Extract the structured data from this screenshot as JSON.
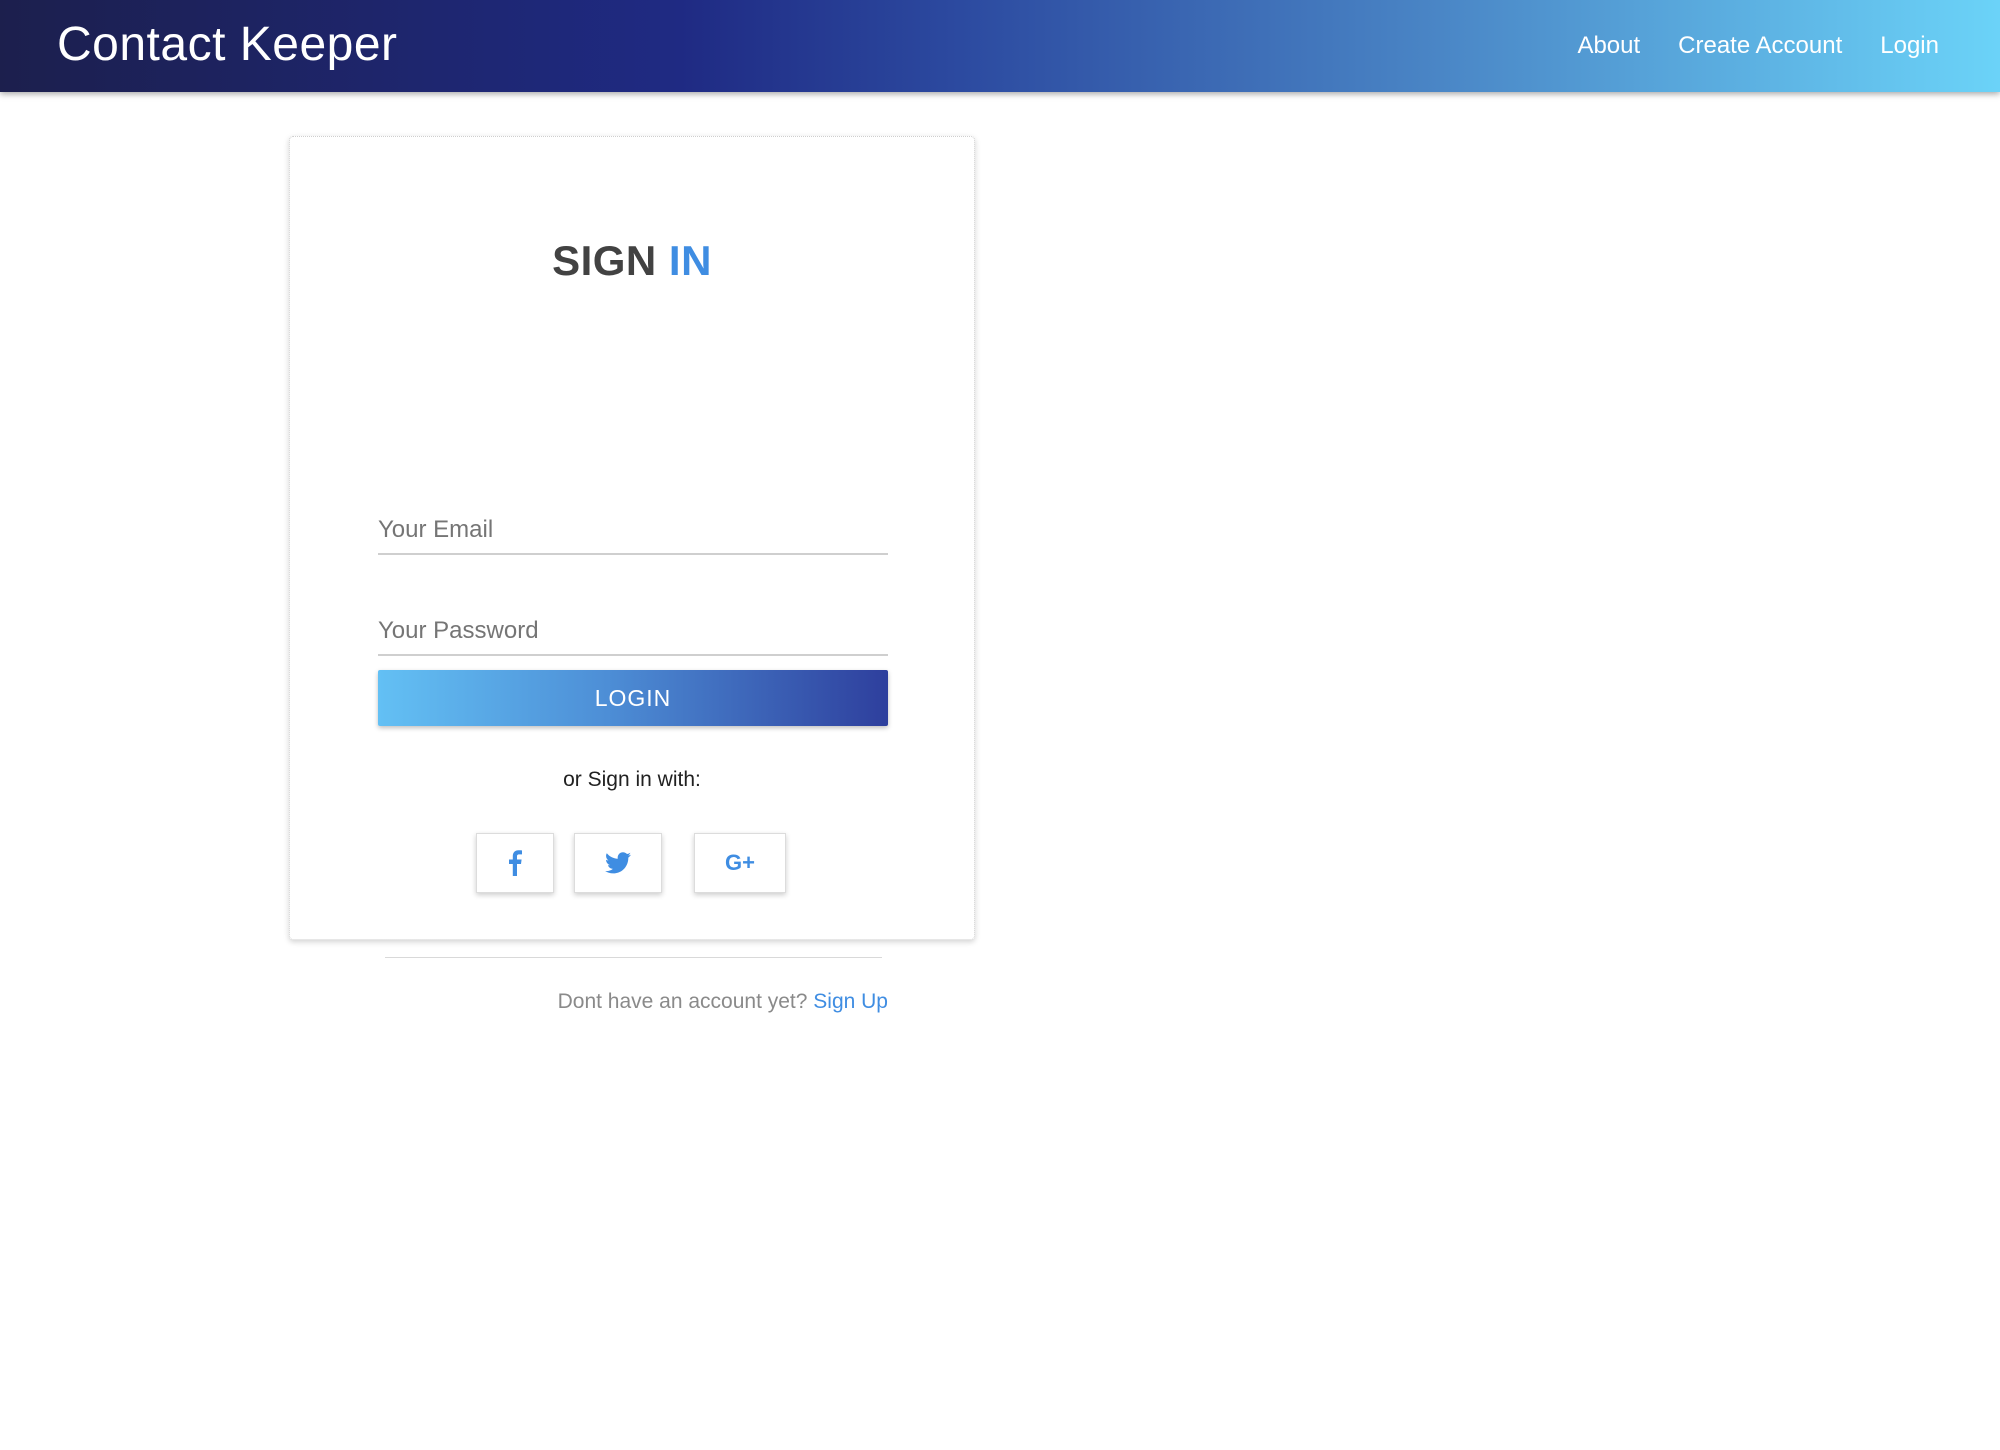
{
  "navbar": {
    "brand": "Contact Keeper",
    "links": [
      {
        "label": "About"
      },
      {
        "label": "Create Account"
      },
      {
        "label": "Login"
      }
    ]
  },
  "signin": {
    "title_part1": "SIGN",
    "title_part2": "IN",
    "email_placeholder": "Your Email",
    "password_placeholder": "Your Password",
    "email_value": "",
    "password_value": "",
    "login_button": "LOGIN",
    "alt_text": "or Sign in with:",
    "social": [
      {
        "icon": "facebook-icon"
      },
      {
        "icon": "twitter-icon"
      },
      {
        "icon": "google-plus-icon",
        "label": "G+"
      }
    ],
    "footer_text": "Dont have an account yet?",
    "signup_link": "Sign Up"
  },
  "colors": {
    "accent": "#3f8de2",
    "title_dark": "#424242"
  }
}
